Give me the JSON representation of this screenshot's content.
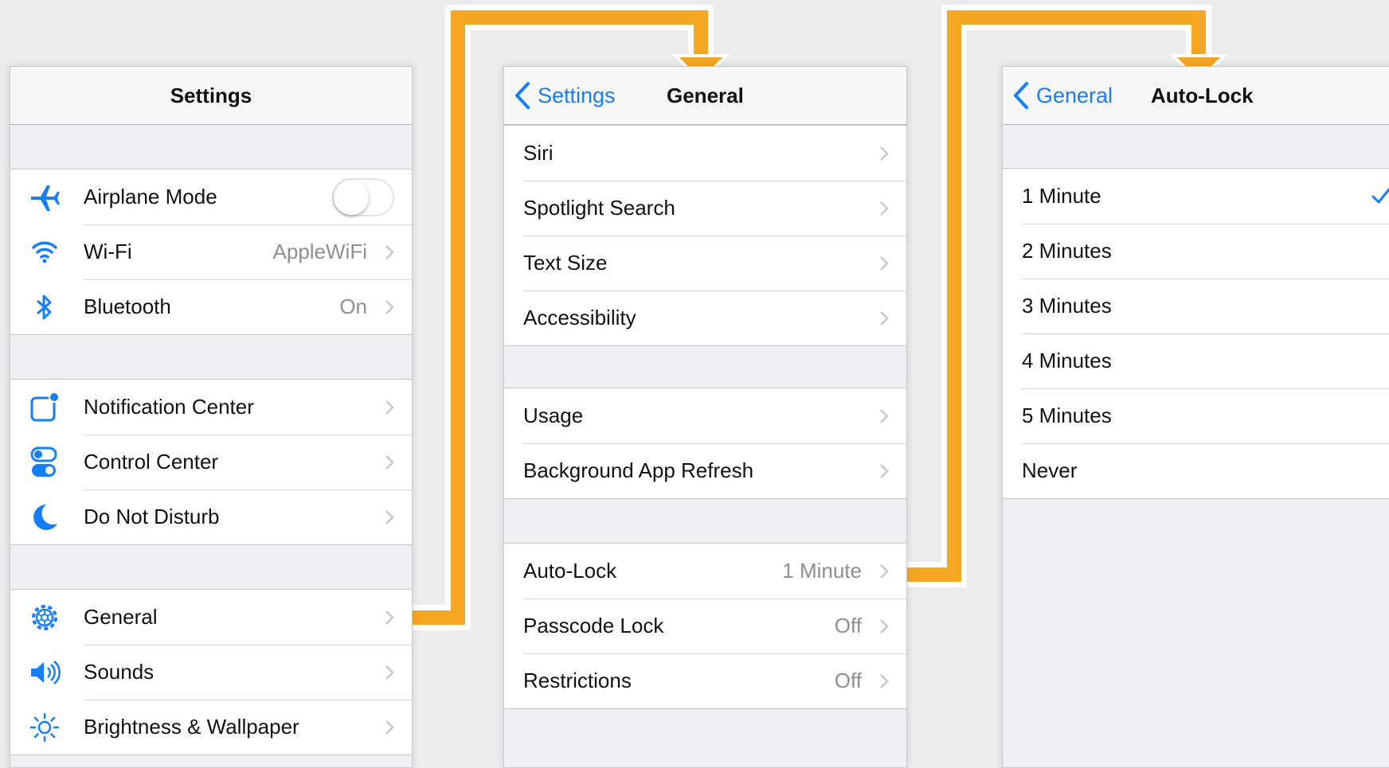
{
  "settings_panel": {
    "title": "Settings",
    "groups": [
      {
        "items": [
          {
            "label": "Airplane Mode",
            "icon": "airplane-icon",
            "toggle_on": false
          },
          {
            "label": "Wi-Fi",
            "icon": "wifi-icon",
            "value": "AppleWiFi"
          },
          {
            "label": "Bluetooth",
            "icon": "bluetooth-icon",
            "value": "On"
          }
        ]
      },
      {
        "items": [
          {
            "label": "Notification Center",
            "icon": "notification-center-icon"
          },
          {
            "label": "Control Center",
            "icon": "control-center-icon"
          },
          {
            "label": "Do Not Disturb",
            "icon": "moon-icon"
          }
        ]
      },
      {
        "items": [
          {
            "label": "General",
            "icon": "gear-icon"
          },
          {
            "label": "Sounds",
            "icon": "speaker-icon"
          },
          {
            "label": "Brightness & Wallpaper",
            "icon": "brightness-icon"
          }
        ]
      }
    ]
  },
  "general_panel": {
    "back_label": "Settings",
    "title": "General",
    "groups": [
      {
        "items": [
          {
            "label": "Siri"
          },
          {
            "label": "Spotlight Search"
          },
          {
            "label": "Text Size"
          },
          {
            "label": "Accessibility"
          }
        ]
      },
      {
        "items": [
          {
            "label": "Usage"
          },
          {
            "label": "Background App Refresh"
          }
        ]
      },
      {
        "items": [
          {
            "label": "Auto-Lock",
            "value": "1 Minute"
          },
          {
            "label": "Passcode Lock",
            "value": "Off"
          },
          {
            "label": "Restrictions",
            "value": "Off"
          }
        ]
      }
    ]
  },
  "autolock_panel": {
    "back_label": "General",
    "title": "Auto-Lock",
    "options": [
      "1 Minute",
      "2 Minutes",
      "3 Minutes",
      "4 Minutes",
      "5 Minutes",
      "Never"
    ],
    "selected_option": "1 Minute"
  },
  "colors": {
    "accent": "#157efb",
    "arrow": "#f5a623",
    "background": "#ececec",
    "group_background": "#efeff4"
  }
}
